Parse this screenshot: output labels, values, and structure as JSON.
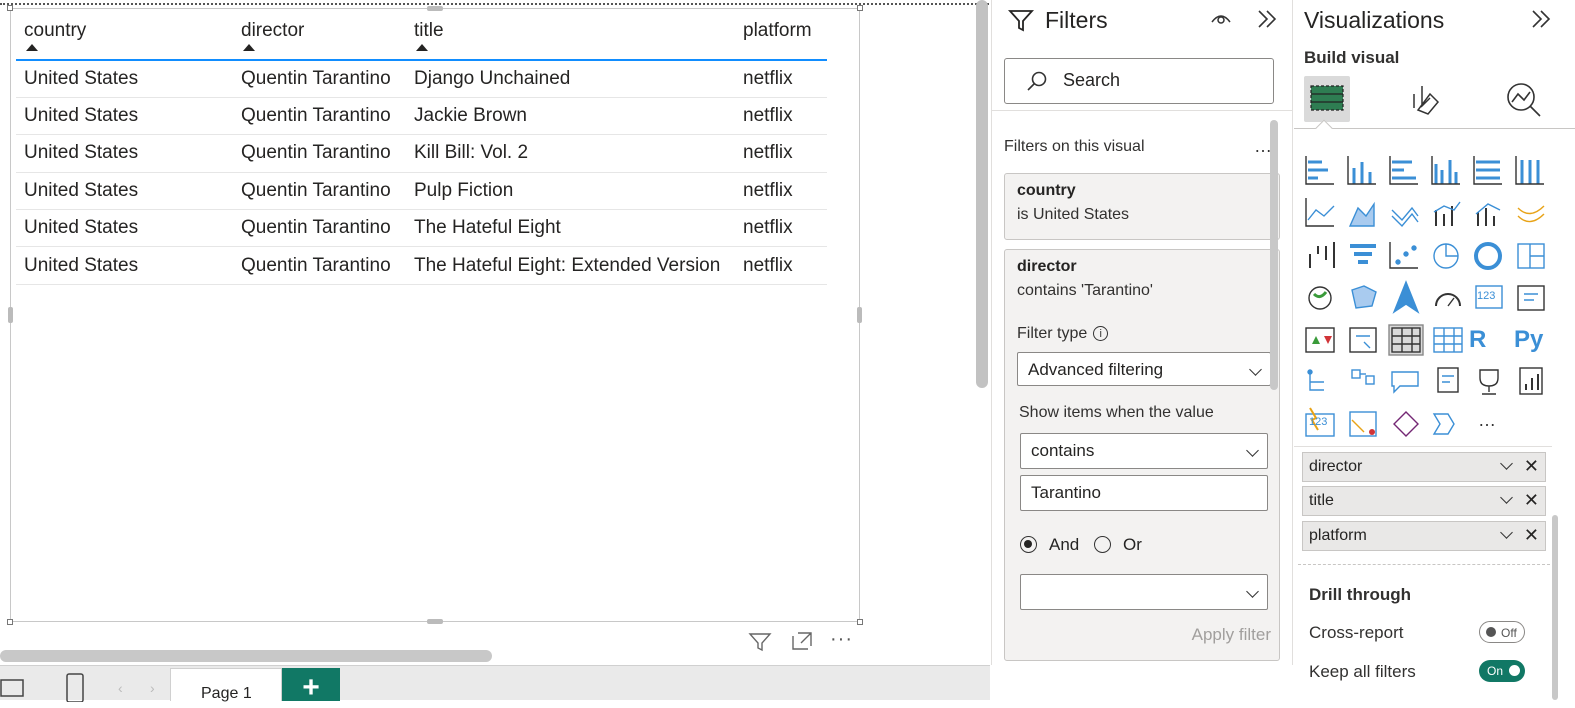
{
  "table": {
    "headers": [
      "country",
      "director",
      "title",
      "platform"
    ],
    "rows": [
      [
        "United States",
        "Quentin Tarantino",
        "Django Unchained",
        "netflix"
      ],
      [
        "United States",
        "Quentin Tarantino",
        "Jackie Brown",
        "netflix"
      ],
      [
        "United States",
        "Quentin Tarantino",
        "Kill Bill: Vol. 2",
        "netflix"
      ],
      [
        "United States",
        "Quentin Tarantino",
        "Pulp Fiction",
        "netflix"
      ],
      [
        "United States",
        "Quentin Tarantino",
        "The Hateful Eight",
        "netflix"
      ],
      [
        "United States",
        "Quentin Tarantino",
        "The Hateful Eight: Extended Version",
        "netflix"
      ]
    ]
  },
  "bottom": {
    "page_tab": "Page 1",
    "add_page": "+"
  },
  "filters": {
    "title": "Filters",
    "search_placeholder": "Search",
    "section": "Filters on this visual",
    "section_more": "…",
    "country_card": {
      "field": "country",
      "condition": "is United States"
    },
    "director_card": {
      "field": "director",
      "condition": "contains 'Tarantino'",
      "filter_type_label": "Filter type",
      "filter_type_value": "Advanced filtering",
      "show_items_label": "Show items when the value",
      "operator": "contains",
      "value": "Tarantino",
      "and_label": "And",
      "or_label": "Or",
      "apply_label": "Apply filter"
    }
  },
  "viz": {
    "title": "Visualizations",
    "build_visual": "Build visual",
    "more": "…",
    "r_label": "R",
    "py_label": "Py",
    "kpi_label": "123",
    "wells": [
      "director",
      "title",
      "platform"
    ],
    "drill_through": "Drill through",
    "cross_report": {
      "label": "Cross-report",
      "state": "Off"
    },
    "keep_filters": {
      "label": "Keep all filters",
      "state": "On"
    }
  },
  "colors": {
    "accent": "#118dff",
    "brand_green": "#117865",
    "viz_blue": "#3b8fd6"
  }
}
